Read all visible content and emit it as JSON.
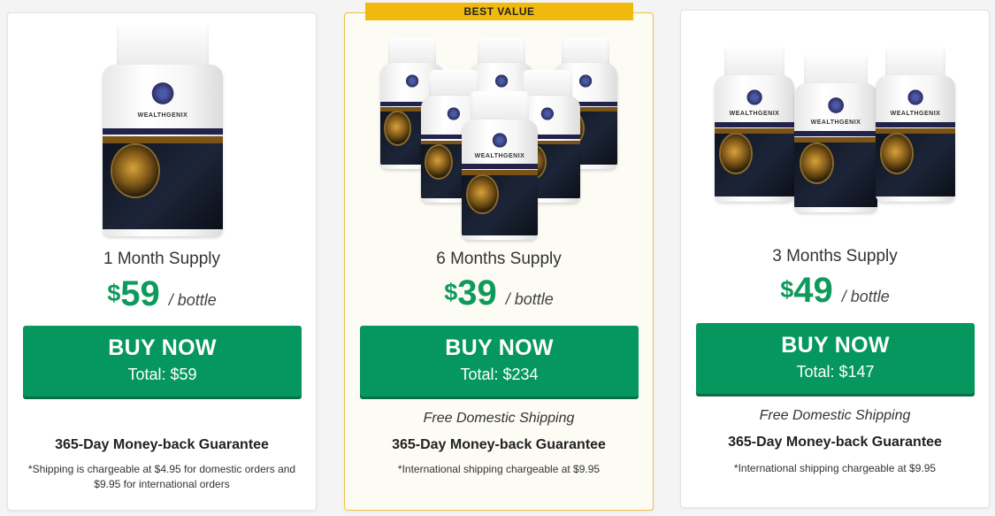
{
  "cards": [
    {
      "supply": "1 Month Supply",
      "currency": "$",
      "price": "59",
      "per_bottle": "/ bottle",
      "buy_label": "BUY NOW",
      "total": "Total: $59",
      "guarantee": "365-Day Money-back Guarantee",
      "footnote": "*Shipping is chargeable at $4.95 for domestic orders and $9.95 for international orders"
    },
    {
      "badge": "BEST VALUE",
      "supply": "6 Months Supply",
      "currency": "$",
      "price": "39",
      "per_bottle": "/ bottle",
      "buy_label": "BUY NOW",
      "total": "Total: $234",
      "shipping": "Free Domestic Shipping",
      "guarantee": "365-Day Money-back Guarantee",
      "footnote": "*International shipping chargeable at $9.95"
    },
    {
      "supply": "3 Months Supply",
      "currency": "$",
      "price": "49",
      "per_bottle": "/ bottle",
      "buy_label": "BUY NOW",
      "total": "Total: $147",
      "shipping": "Free Domestic Shipping",
      "guarantee": "365-Day Money-back Guarantee",
      "footnote": "*International shipping chargeable at $9.95"
    }
  ],
  "product": {
    "bottle_brand": "WEALTHGENIX"
  },
  "colors": {
    "accent_green": "#06975f",
    "price_green": "#0e9a5c",
    "badge_gold": "#f1b90d"
  }
}
